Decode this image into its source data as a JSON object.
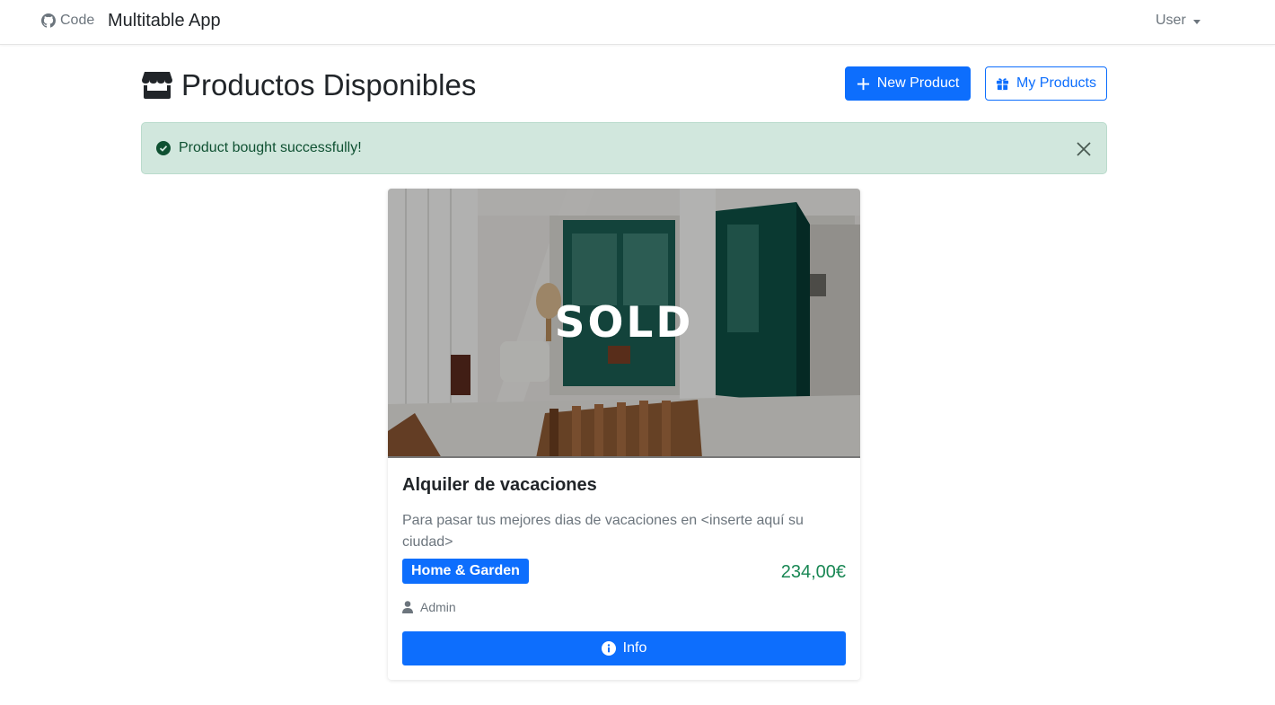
{
  "navbar": {
    "code_label": "Code",
    "brand": "Multitable App",
    "user_menu": "User"
  },
  "header": {
    "title": "Productos Disponibles",
    "new_product_label": "New Product",
    "my_products_label": "My Products"
  },
  "alert": {
    "message": "Product bought successfully!"
  },
  "product": {
    "sold_label": "SOLD",
    "title": "Alquiler de vacaciones",
    "description": "Para pasar tus mejores dias de vacaciones en <inserte aquí su ciudad>",
    "category": "Home & Garden",
    "price": "234,00€",
    "owner": "Admin",
    "info_label": "Info"
  },
  "colors": {
    "primary": "#0d6efd",
    "success_text": "#0f5132",
    "success_bg": "#d1e7dd",
    "price": "#198754"
  },
  "icons": [
    "github-icon",
    "store-icon",
    "plus-icon",
    "gift-icon",
    "check-circle-icon",
    "close-icon",
    "user-icon",
    "info-circle-icon"
  ]
}
